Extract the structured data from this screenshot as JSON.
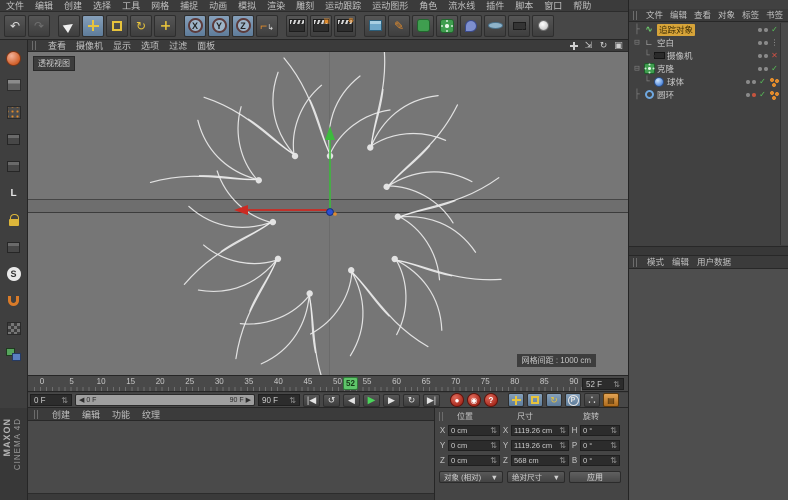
{
  "menubar": {
    "items": [
      "文件",
      "编辑",
      "创建",
      "选择",
      "工具",
      "网格",
      "捕捉",
      "动画",
      "模拟",
      "渲染",
      "雕刻",
      "运动跟踪",
      "运动图形",
      "角色",
      "流水线",
      "插件",
      "脚本",
      "窗口",
      "帮助"
    ]
  },
  "toolbar": {
    "axis_x": "X",
    "axis_y": "Y",
    "axis_z": "Z"
  },
  "leftbar": {
    "snap_label": "S",
    "axis_label": "L"
  },
  "viewport": {
    "menu": [
      "查看",
      "摄像机",
      "显示",
      "选项",
      "过滤",
      "面板"
    ],
    "view_label": "透视视图",
    "grid_label": "网格间距 : 1000 cm"
  },
  "timeline": {
    "ticks": [
      "0",
      "5",
      "10",
      "15",
      "20",
      "25",
      "30",
      "35",
      "40",
      "45",
      "50",
      "55",
      "60",
      "65",
      "70",
      "75",
      "80",
      "85",
      "90"
    ],
    "playhead": "52",
    "frame_field": "52 F"
  },
  "transport": {
    "start": "0 F",
    "end": "90 F",
    "range_start": "0 F",
    "range_end": "90 F",
    "goto_start": "|◀",
    "prev_key": "↺",
    "prev_frame": "◀",
    "play": "▶",
    "next_frame": "▶",
    "next_key": "↻",
    "goto_end": "▶|",
    "autokey_q": "?",
    "p_label": "P",
    "pla_label": "∴"
  },
  "materials": {
    "menu": [
      "创建",
      "编辑",
      "功能",
      "纹理"
    ]
  },
  "coordinates": {
    "title_pos": "位置",
    "title_size": "尺寸",
    "title_rot": "旋转",
    "rows": [
      {
        "pl": "X",
        "pv": "0 cm",
        "sl": "X",
        "sv": "1119.26 cm",
        "rl": "H",
        "rv": "0 °"
      },
      {
        "pl": "Y",
        "pv": "0 cm",
        "sl": "Y",
        "sv": "1119.26 cm",
        "rl": "P",
        "rv": "0 °"
      },
      {
        "pl": "Z",
        "pv": "0 cm",
        "sl": "Z",
        "sv": "568 cm",
        "rl": "B",
        "rv": "0 °"
      }
    ],
    "mode_dropdown": "对象 (相对)",
    "size_dropdown": "绝对尺寸",
    "apply_button": "应用"
  },
  "object_manager": {
    "menu": [
      "文件",
      "编辑",
      "查看",
      "对象",
      "标签",
      "书签"
    ],
    "objects": [
      {
        "name": "追踪对象",
        "state": "✓"
      },
      {
        "name": "空白",
        "state": "⋮"
      },
      {
        "name": "摄像机",
        "state": "✕"
      },
      {
        "name": "克隆",
        "state": "✓"
      },
      {
        "name": "球体",
        "state": "✓"
      },
      {
        "name": "圆环",
        "state": "✓"
      }
    ]
  },
  "attribute_manager": {
    "menu": [
      "模式",
      "编辑",
      "用户数据"
    ]
  },
  "branding": {
    "name": "MAXON",
    "product": "CINEMA 4D"
  }
}
